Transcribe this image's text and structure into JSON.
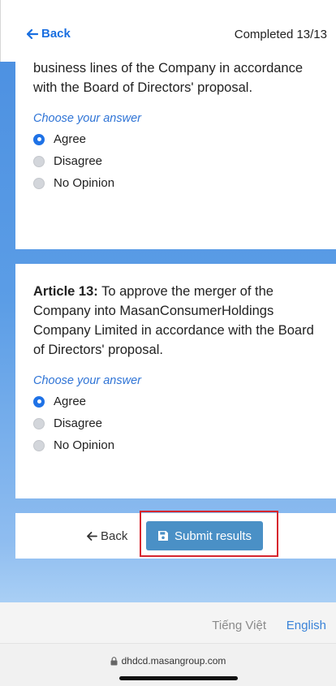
{
  "header": {
    "back_label": "Back",
    "progress_text": "Completed 13/13"
  },
  "questions": [
    {
      "text_tail": "business lines of the Company in accordance with the Board of Directors' proposal.",
      "choose_label": "Choose your answer",
      "options": [
        "Agree",
        "Disagree",
        "No Opinion"
      ],
      "selected": "Agree"
    },
    {
      "article_label": "Article 13:",
      "text": " To approve the merger of the Company into MasanConsumerHoldings Company Limited in accordance with the Board of Directors' proposal.",
      "choose_label": "Choose your answer",
      "options": [
        "Agree",
        "Disagree",
        "No Opinion"
      ],
      "selected": "Agree"
    }
  ],
  "actions": {
    "back_label": "Back",
    "submit_label": "Submit results"
  },
  "footer": {
    "lang_vi": "Tiếng Việt",
    "lang_en": "English"
  },
  "browser": {
    "url": "dhdcd.masangroup.com"
  },
  "colors": {
    "accent": "#1a6fe0",
    "submit_bg": "#4a90c6",
    "highlight": "#d7262e"
  }
}
